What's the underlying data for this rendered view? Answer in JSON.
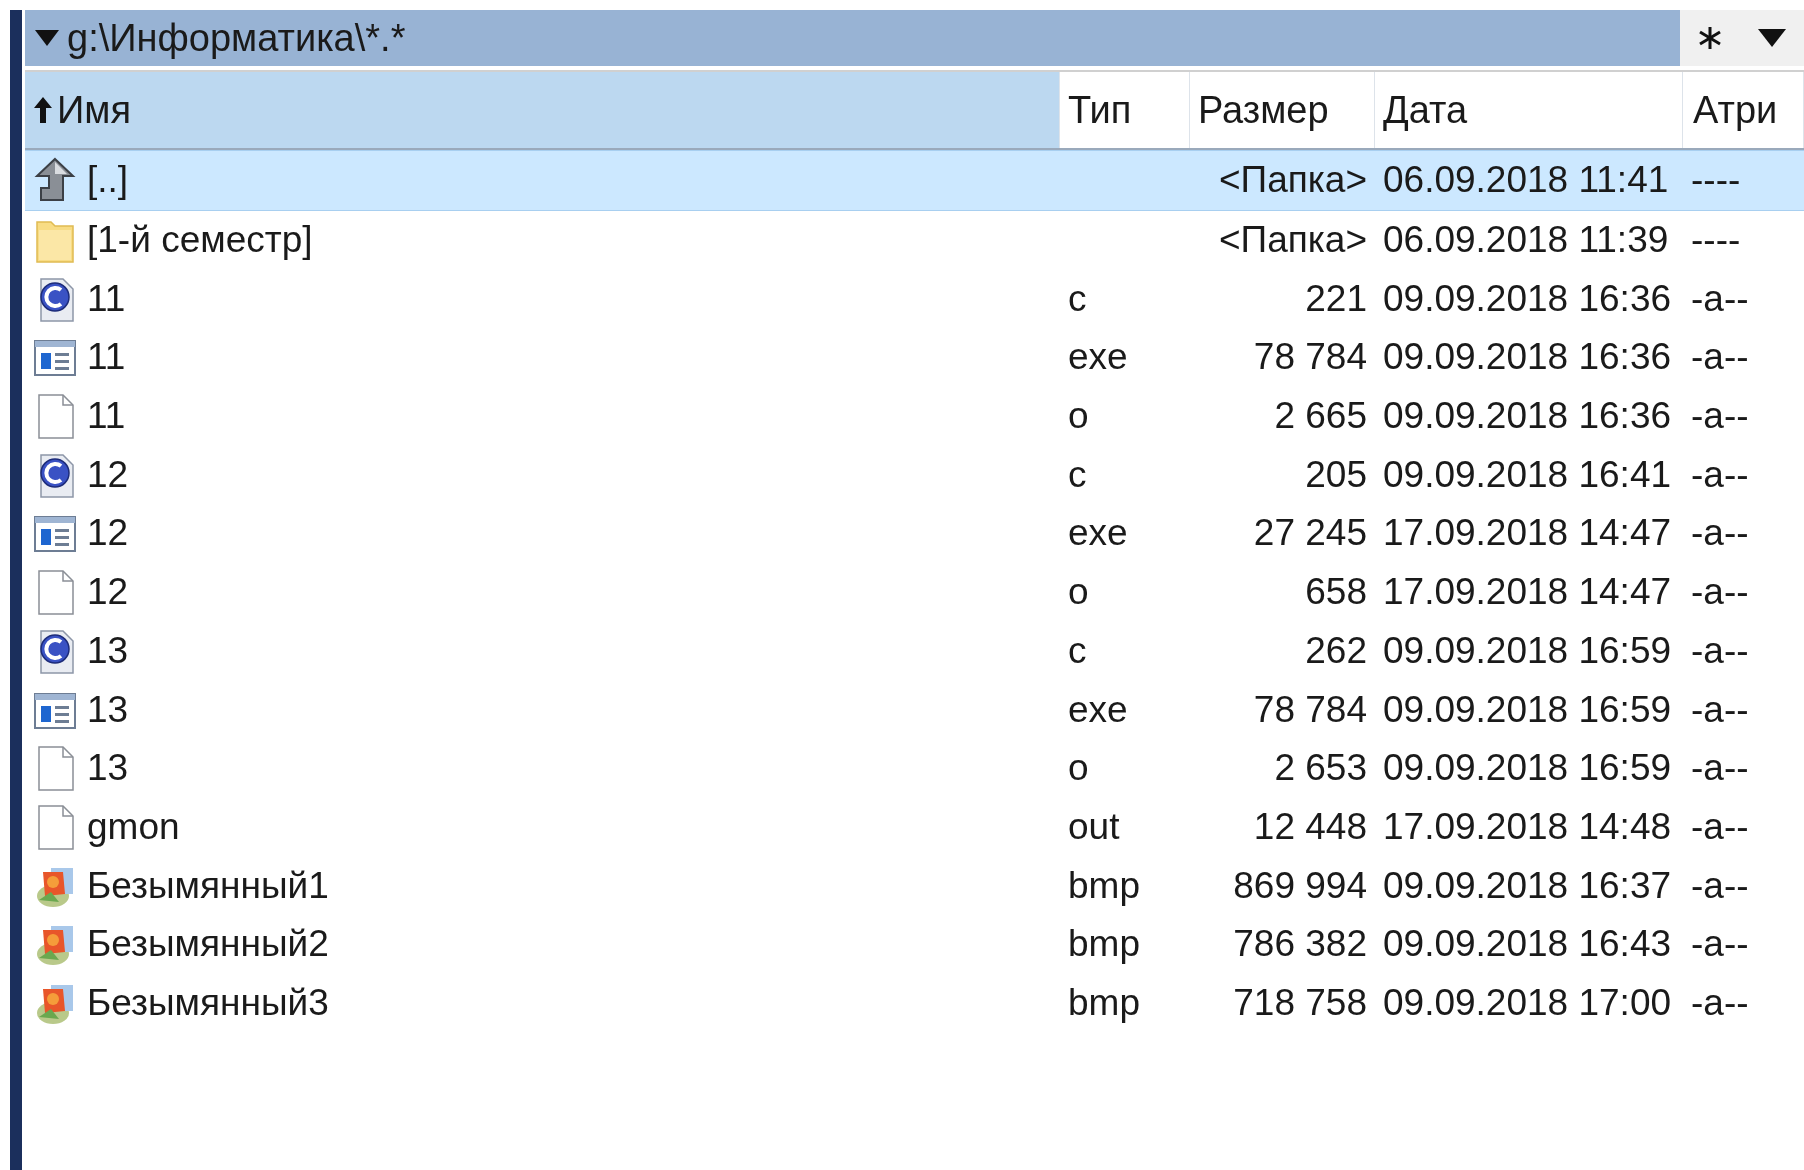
{
  "path_bar": {
    "path": "g:\\Информатика\\*.*"
  },
  "columns": [
    {
      "label": "Имя",
      "sorted": true
    },
    {
      "label": "Тип",
      "sorted": false
    },
    {
      "label": "Размер",
      "sorted": false
    },
    {
      "label": "Дата",
      "sorted": false
    },
    {
      "label": "Атри",
      "sorted": false
    }
  ],
  "rows": [
    {
      "kind": "up",
      "name": "[..]",
      "type": "",
      "size": "<Папка>",
      "date": "06.09.2018 11:41",
      "attr": "----",
      "selected": true
    },
    {
      "kind": "folder",
      "name": "[1-й семестр]",
      "type": "",
      "size": "<Папка>",
      "date": "06.09.2018 11:39",
      "attr": "----",
      "selected": false
    },
    {
      "kind": "c",
      "name": "11",
      "type": "c",
      "size": "221",
      "date": "09.09.2018 16:36",
      "attr": "-a--",
      "selected": false
    },
    {
      "kind": "exe",
      "name": "11",
      "type": "exe",
      "size": "78 784",
      "date": "09.09.2018 16:36",
      "attr": "-a--",
      "selected": false
    },
    {
      "kind": "file",
      "name": "11",
      "type": "o",
      "size": "2 665",
      "date": "09.09.2018 16:36",
      "attr": "-a--",
      "selected": false
    },
    {
      "kind": "c",
      "name": "12",
      "type": "c",
      "size": "205",
      "date": "09.09.2018 16:41",
      "attr": "-a--",
      "selected": false
    },
    {
      "kind": "exe",
      "name": "12",
      "type": "exe",
      "size": "27 245",
      "date": "17.09.2018 14:47",
      "attr": "-a--",
      "selected": false
    },
    {
      "kind": "file",
      "name": "12",
      "type": "o",
      "size": "658",
      "date": "17.09.2018 14:47",
      "attr": "-a--",
      "selected": false
    },
    {
      "kind": "c",
      "name": "13",
      "type": "c",
      "size": "262",
      "date": "09.09.2018 16:59",
      "attr": "-a--",
      "selected": false
    },
    {
      "kind": "exe",
      "name": "13",
      "type": "exe",
      "size": "78 784",
      "date": "09.09.2018 16:59",
      "attr": "-a--",
      "selected": false
    },
    {
      "kind": "file",
      "name": "13",
      "type": "o",
      "size": "2 653",
      "date": "09.09.2018 16:59",
      "attr": "-a--",
      "selected": false
    },
    {
      "kind": "file",
      "name": "gmon",
      "type": "out",
      "size": "12 448",
      "date": "17.09.2018 14:48",
      "attr": "-a--",
      "selected": false
    },
    {
      "kind": "bmp",
      "name": "Безымянный1",
      "type": "bmp",
      "size": "869 994",
      "date": "09.09.2018 16:37",
      "attr": "-a--",
      "selected": false
    },
    {
      "kind": "bmp",
      "name": "Безымянный2",
      "type": "bmp",
      "size": "786 382",
      "date": "09.09.2018 16:43",
      "attr": "-a--",
      "selected": false
    },
    {
      "kind": "bmp",
      "name": "Безымянный3",
      "type": "bmp",
      "size": "718 758",
      "date": "09.09.2018 17:00",
      "attr": "-a--",
      "selected": false
    }
  ]
}
